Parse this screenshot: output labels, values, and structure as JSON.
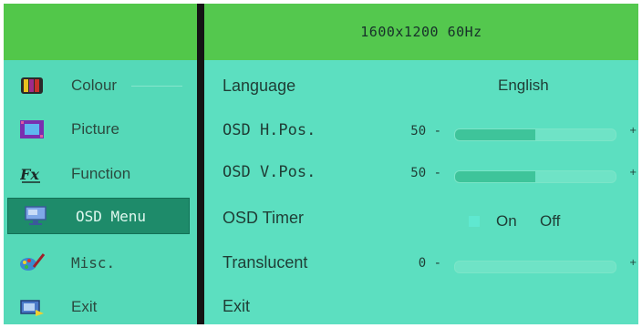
{
  "resolution": "1600x1200 60Hz",
  "sidebar": {
    "items": [
      {
        "label": "Colour",
        "icon": "colour-bars-icon"
      },
      {
        "label": "Picture",
        "icon": "picture-frame-icon"
      },
      {
        "label": "Function",
        "icon": "function-fx-icon"
      },
      {
        "label": "OSD Menu",
        "icon": "osd-monitor-icon",
        "active": true
      },
      {
        "label": "Misc.",
        "icon": "misc-paint-icon"
      },
      {
        "label": "Exit",
        "icon": "exit-icon"
      }
    ]
  },
  "main": {
    "language": {
      "label": "Language",
      "value": "English"
    },
    "h_pos": {
      "label": "OSD H.Pos.",
      "value": "50",
      "level": 0.5
    },
    "v_pos": {
      "label": "OSD V.Pos.",
      "value": "50",
      "level": 0.5
    },
    "timer": {
      "label": "OSD Timer",
      "on": "On",
      "off": "Off"
    },
    "translucent": {
      "label": "Translucent",
      "value": "0",
      "level": 0
    },
    "exit": {
      "label": "Exit"
    }
  },
  "colors": {
    "header_green": "#52c74a",
    "menu_bg": "#56dcbc",
    "active_item": "#1e8b6a"
  }
}
